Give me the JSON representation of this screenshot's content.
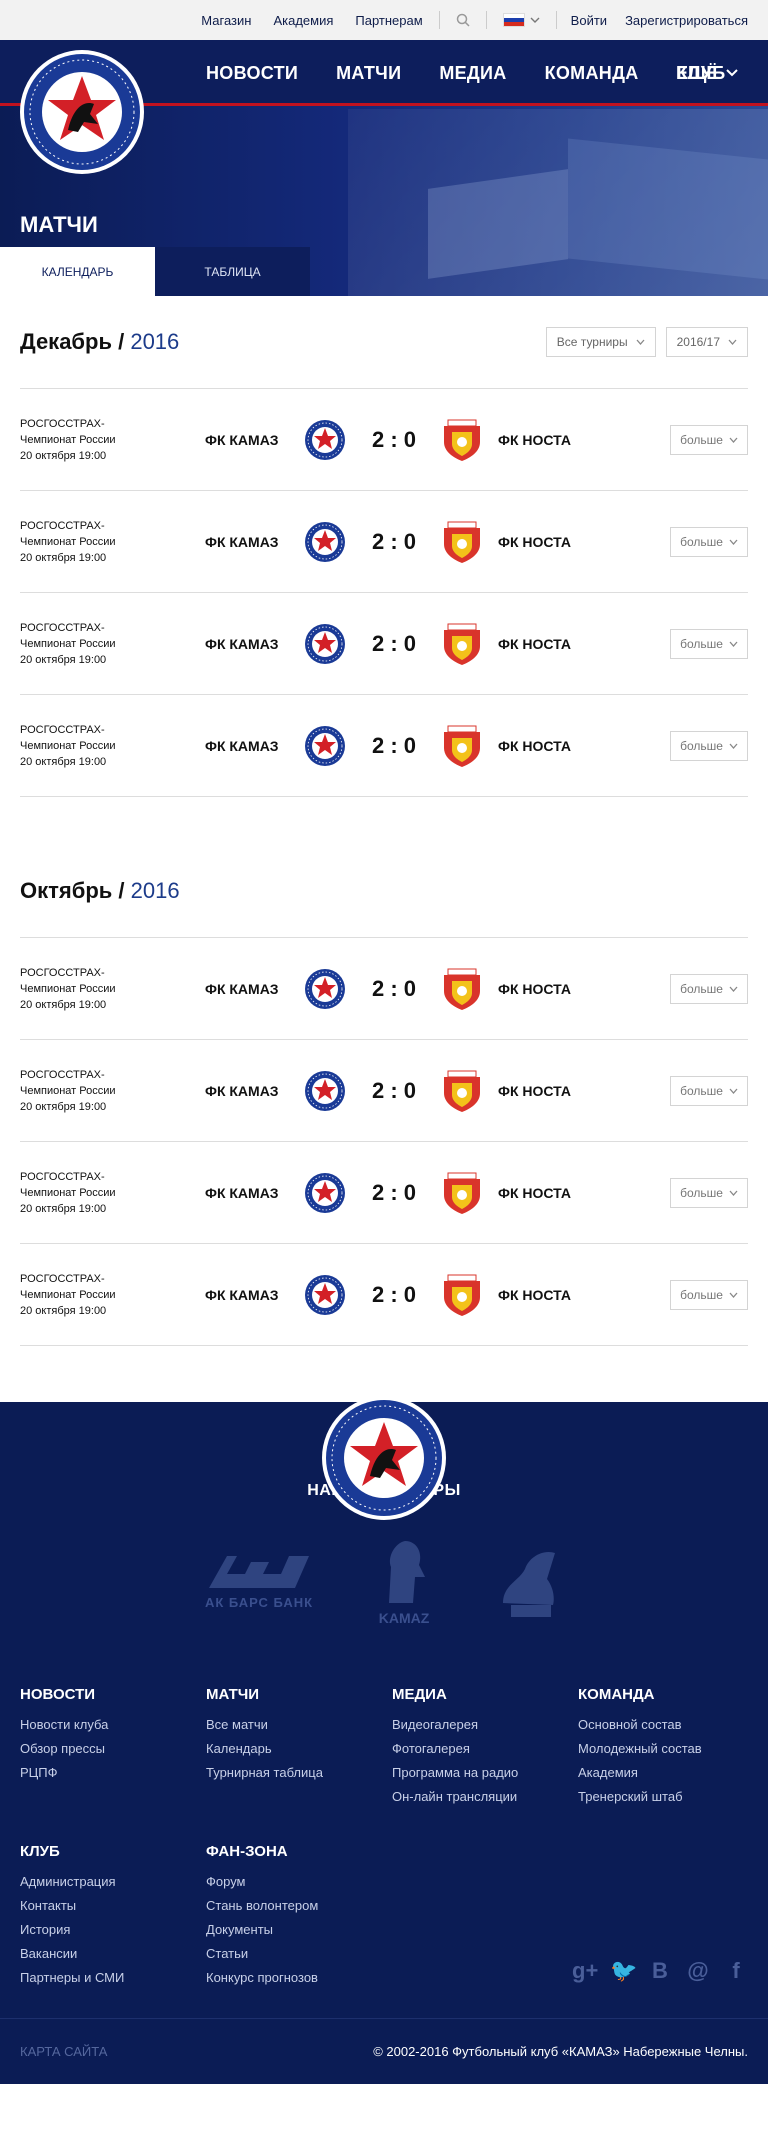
{
  "topbar": {
    "links": [
      "Магазин",
      "Академия",
      "Партнерам"
    ],
    "login": "Войти",
    "register": "Зарегистрироваться"
  },
  "logo": {
    "text": "ФУТБОЛЬНЫЙ КЛУБ «КАМАЗ»"
  },
  "nav": {
    "items": [
      "НОВОСТИ",
      "МАТЧИ",
      "МЕДИА",
      "КОМАНДА",
      "КЛУБ"
    ],
    "more": "ЕЩЁ"
  },
  "page": {
    "title": "МАТЧИ",
    "tabs": [
      "КАЛЕНДАРЬ",
      "ТАБЛИЦА"
    ]
  },
  "filters": {
    "tournament": "Все турниры",
    "season": "2016/17"
  },
  "months": [
    {
      "name": "Декабрь /",
      "year": "2016",
      "matches": [
        {
          "tournament": "РОСГОССТРАХ-\nЧемпионат России\n20 октября 19:00",
          "home": "ФК КАМАЗ",
          "score": "2 : 0",
          "away": "ФК НОСТА",
          "more": "больше"
        },
        {
          "tournament": "РОСГОССТРАХ-\nЧемпионат России\n20 октября 19:00",
          "home": "ФК КАМАЗ",
          "score": "2 : 0",
          "away": "ФК НОСТА",
          "more": "больше"
        },
        {
          "tournament": "РОСГОССТРАХ-\nЧемпионат России\n20 октября 19:00",
          "home": "ФК КАМАЗ",
          "score": "2 : 0",
          "away": "ФК НОСТА",
          "more": "больше"
        },
        {
          "tournament": "РОСГОССТРАХ-\nЧемпионат России\n20 октября 19:00",
          "home": "ФК КАМАЗ",
          "score": "2 : 0",
          "away": "ФК НОСТА",
          "more": "больше"
        }
      ]
    },
    {
      "name": "Октябрь /",
      "year": "2016",
      "matches": [
        {
          "tournament": "РОСГОССТРАХ-\nЧемпионат России\n20 октября 19:00",
          "home": "ФК КАМАЗ",
          "score": "2 : 0",
          "away": "ФК НОСТА",
          "more": "больше"
        },
        {
          "tournament": "РОСГОССТРАХ-\nЧемпионат России\n20 октября 19:00",
          "home": "ФК КАМАЗ",
          "score": "2 : 0",
          "away": "ФК НОСТА",
          "more": "больше"
        },
        {
          "tournament": "РОСГОССТРАХ-\nЧемпионат России\n20 октября 19:00",
          "home": "ФК КАМАЗ",
          "score": "2 : 0",
          "away": "ФК НОСТА",
          "more": "больше"
        },
        {
          "tournament": "РОСГОССТРАХ-\nЧемпионат России\n20 октября 19:00",
          "home": "ФК КАМАЗ",
          "score": "2 : 0",
          "away": "ФК НОСТА",
          "more": "больше"
        }
      ]
    }
  ],
  "partners": {
    "title": "НАШИ ПАРТНЕРЫ",
    "logos": [
      "АК БАРС БАНК",
      "KAMAZ",
      "ship-emblem"
    ]
  },
  "footer": {
    "columns": [
      {
        "title": "НОВОСТИ",
        "links": [
          "Новости клуба",
          "Обзор прессы",
          "РЦПФ"
        ]
      },
      {
        "title": "МАТЧИ",
        "links": [
          "Все матчи",
          "Календарь",
          "Турнирная таблица"
        ]
      },
      {
        "title": "МЕДИА",
        "links": [
          "Видеогалерея",
          "Фотогалерея",
          "Программа на радио",
          "Он-лайн трансляции"
        ]
      },
      {
        "title": "КОМАНДА",
        "links": [
          "Основной состав",
          "Молодежный состав",
          "Академия",
          "Тренерский штаб"
        ]
      },
      {
        "title": "КЛУБ",
        "links": [
          "Администрация",
          "Контакты",
          "История",
          "Вакансии",
          "Партнеры и СМИ"
        ]
      },
      {
        "title": "ФАН-ЗОНА",
        "links": [
          "Форум",
          "Стань волонтером",
          "Документы",
          "Статьи",
          "Конкурс прогнозов"
        ]
      }
    ],
    "social_icons": [
      "google-plus-icon",
      "twitter-icon",
      "vk-icon",
      "email-icon",
      "facebook-icon"
    ],
    "social_glyphs": [
      "g+",
      "🐦",
      "В",
      "@",
      "f"
    ],
    "sitemap": "КАРТА САЙТА",
    "copyright": "© 2002-2016 Футбольный клуб «КАМАЗ» Набережные Челны."
  },
  "colors": {
    "navy": "#0d1e5c",
    "accent_red": "#c1121f",
    "year_blue": "#1c3b8a"
  }
}
